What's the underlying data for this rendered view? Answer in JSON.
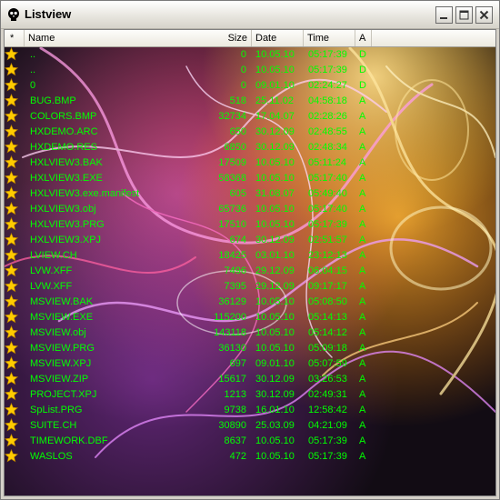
{
  "window": {
    "title": "Listview"
  },
  "header": {
    "star": "*",
    "name": "Name",
    "size": "Size",
    "date": "Date",
    "time": "Time",
    "attr": "A"
  },
  "files": [
    {
      "name": "..",
      "size": "0",
      "date": "10.05.10",
      "time": "05:17:39",
      "attr": "D"
    },
    {
      "name": "..",
      "size": "0",
      "date": "10.05.10",
      "time": "05:17:39",
      "attr": "D"
    },
    {
      "name": "0",
      "size": "0",
      "date": "09.01.10",
      "time": "02:24:27",
      "attr": "D"
    },
    {
      "name": "BUG.BMP",
      "size": "518",
      "date": "25.11.02",
      "time": "04:58:18",
      "attr": "A"
    },
    {
      "name": "COLORS.BMP",
      "size": "32734",
      "date": "17.04.07",
      "time": "02:28:26",
      "attr": "A"
    },
    {
      "name": "HXDEMO.ARC",
      "size": "650",
      "date": "30.12.09",
      "time": "02:48:55",
      "attr": "A"
    },
    {
      "name": "HXDEMO.RES",
      "size": "6850",
      "date": "30.12.09",
      "time": "02:48:34",
      "attr": "A"
    },
    {
      "name": "HXLVIEW3.BAK",
      "size": "17509",
      "date": "10.05.10",
      "time": "05:11:24",
      "attr": "A"
    },
    {
      "name": "HXLVIEW3.EXE",
      "size": "58368",
      "date": "10.05.10",
      "time": "05:17:40",
      "attr": "A"
    },
    {
      "name": "HXLVIEW3.exe.manifest",
      "size": "605",
      "date": "31.08.07",
      "time": "05:49:40",
      "attr": "A"
    },
    {
      "name": "HXLVIEW3.obj",
      "size": "65736",
      "date": "10.05.10",
      "time": "05:17:40",
      "attr": "A"
    },
    {
      "name": "HXLVIEW3.PRG",
      "size": "17510",
      "date": "10.05.10",
      "time": "05:17:39",
      "attr": "A"
    },
    {
      "name": "HXLVIEW3.XPJ",
      "size": "674",
      "date": "30.12.09",
      "time": "02:51:57",
      "attr": "A"
    },
    {
      "name": "LVIEW.CH",
      "size": "18425",
      "date": "03.01.10",
      "time": "23:12:13",
      "attr": "A"
    },
    {
      "name": "LVW.XFF",
      "size": "7496",
      "date": "29.12.09",
      "time": "06:04:15",
      "attr": "A"
    },
    {
      "name": "LVW.XFF",
      "size": "7395",
      "date": "29.12.09",
      "time": "09:17:17",
      "attr": "A"
    },
    {
      "name": "MSVIEW.BAK",
      "size": "36129",
      "date": "10.05.10",
      "time": "05:08:50",
      "attr": "A"
    },
    {
      "name": "MSVIEW.EXE",
      "size": "115200",
      "date": "10.05.10",
      "time": "05:14:13",
      "attr": "A"
    },
    {
      "name": "MSVIEW.obj",
      "size": "143118",
      "date": "10.05.10",
      "time": "05:14:12",
      "attr": "A"
    },
    {
      "name": "MSVIEW.PRG",
      "size": "36130",
      "date": "10.05.10",
      "time": "05:09:18",
      "attr": "A"
    },
    {
      "name": "MSVIEW.XPJ",
      "size": "697",
      "date": "09.01.10",
      "time": "05:07:59",
      "attr": "A"
    },
    {
      "name": "MSVIEW.ZIP",
      "size": "15617",
      "date": "30.12.09",
      "time": "03:26:53",
      "attr": "A"
    },
    {
      "name": "PROJECT.XPJ",
      "size": "1213",
      "date": "30.12.09",
      "time": "02:49:31",
      "attr": "A"
    },
    {
      "name": "SpList.PRG",
      "size": "9738",
      "date": "16.01.10",
      "time": "12:58:42",
      "attr": "A"
    },
    {
      "name": "SUITE.CH",
      "size": "30890",
      "date": "25.03.09",
      "time": "04:21:09",
      "attr": "A"
    },
    {
      "name": "TIMEWORK.DBF",
      "size": "8637",
      "date": "10.05.10",
      "time": "05:17:39",
      "attr": "A"
    },
    {
      "name": "WASLOS",
      "size": "472",
      "date": "10.05.10",
      "time": "05:17:39",
      "attr": "A"
    }
  ],
  "icons": {
    "app": "skull-icon",
    "row": "star-icon",
    "minimize": "minimize-icon",
    "maximize": "maximize-icon",
    "close": "close-icon"
  },
  "colors": {
    "text": "#00ff00",
    "star": "#ffcc00",
    "background": "#101018"
  }
}
